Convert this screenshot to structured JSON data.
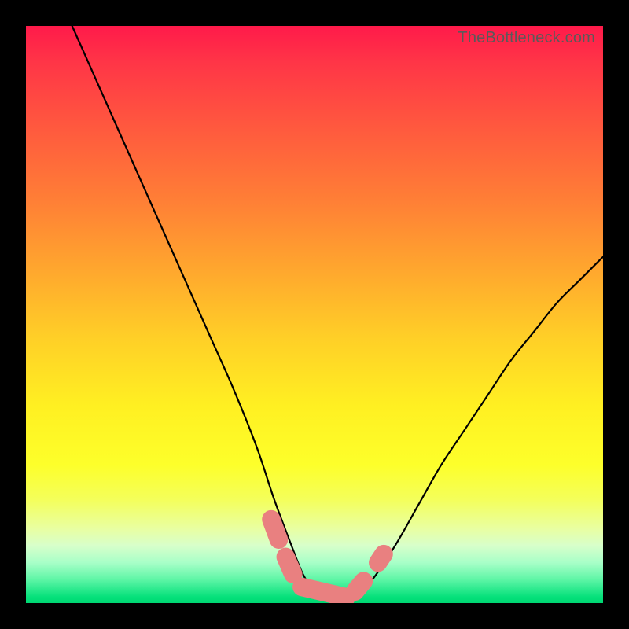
{
  "watermark": "TheBottleneck.com",
  "colors": {
    "frame": "#000000",
    "bead": "#e98080",
    "curve": "#000000"
  },
  "chart_data": {
    "type": "line",
    "title": "",
    "xlabel": "",
    "ylabel": "",
    "xlim": [
      0,
      100
    ],
    "ylim": [
      0,
      100
    ],
    "grid": false,
    "legend": false,
    "note": "V-shaped bottleneck curve on red→green vertical gradient; y≈0 is optimal (green). Values estimated from pixel positions.",
    "series": [
      {
        "name": "bottleneck-curve",
        "x": [
          8,
          12,
          16,
          20,
          24,
          28,
          32,
          36,
          40,
          43,
          46,
          48,
          50,
          52,
          54,
          56,
          58,
          60,
          64,
          68,
          72,
          76,
          80,
          84,
          88,
          92,
          96,
          100
        ],
        "y": [
          100,
          91,
          82,
          73,
          64,
          55,
          46,
          37,
          27,
          18,
          10,
          5,
          2,
          1,
          1,
          1,
          2,
          4,
          10,
          17,
          24,
          30,
          36,
          42,
          47,
          52,
          56,
          60
        ]
      }
    ],
    "beads": {
      "name": "highlight-markers",
      "segments": [
        {
          "x0": 42.5,
          "y0": 14.5,
          "x1": 43.8,
          "y1": 11.0
        },
        {
          "x0": 45.0,
          "y0": 8.0,
          "x1": 46.3,
          "y1": 5.0
        },
        {
          "x0": 47.8,
          "y0": 2.8,
          "x1": 55.5,
          "y1": 1.0
        },
        {
          "x0": 57.0,
          "y0": 2.0,
          "x1": 58.5,
          "y1": 3.8
        },
        {
          "x0": 61.0,
          "y0": 7.0,
          "x1": 62.0,
          "y1": 8.5
        }
      ],
      "radius_pct": 1.6
    }
  }
}
